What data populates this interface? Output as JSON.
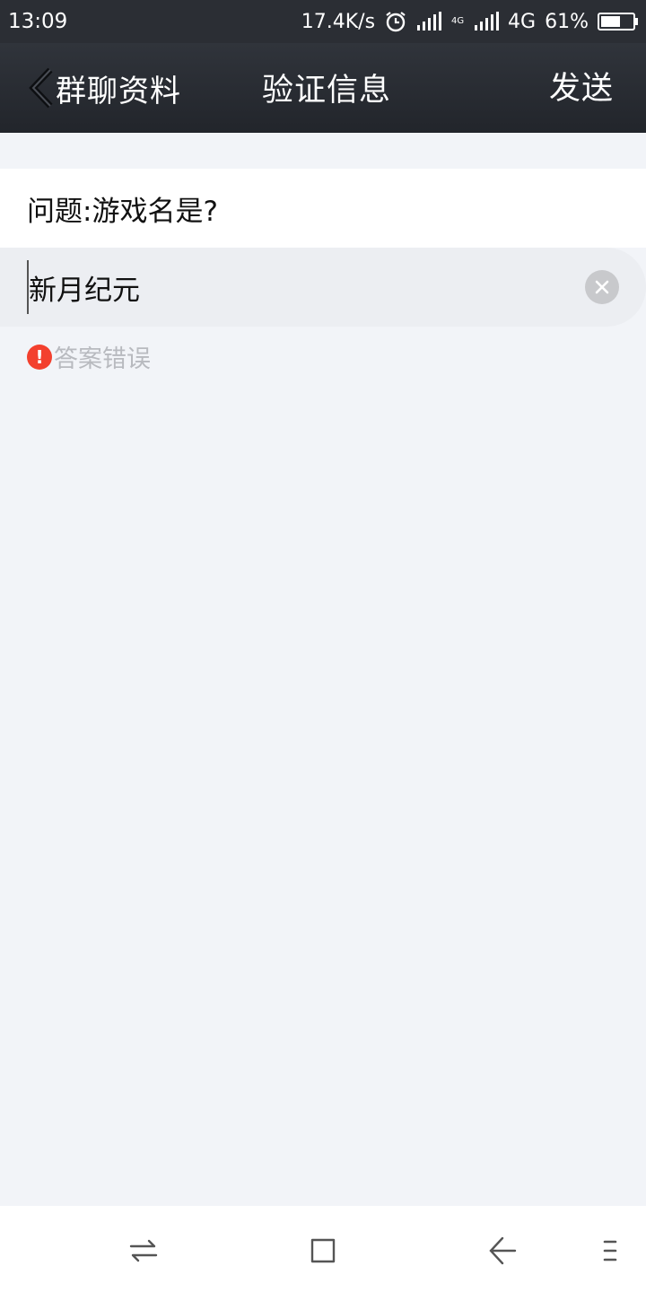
{
  "status_bar": {
    "time": "13:09",
    "net_speed": "17.4K/s",
    "network_small": "4G",
    "network_label": "4G",
    "battery_pct": "61%",
    "battery_level": 0.61,
    "icons": [
      "alarm-icon",
      "signal-icon",
      "signal-icon",
      "battery-icon"
    ]
  },
  "header": {
    "back_label": "群聊资料",
    "title": "验证信息",
    "send_label": "发送"
  },
  "form": {
    "question": "问题:游戏名是?",
    "answer_value": "新月纪元",
    "error_text": "答案错误"
  },
  "nav": {
    "icons": [
      "switch-icon",
      "home-icon",
      "back-arrow-icon",
      "menu-icon"
    ]
  },
  "colors": {
    "header_bg": "#2b2e34",
    "page_bg": "#f2f4f8",
    "error_red": "#f3402e",
    "hint_gray": "#b8babf"
  }
}
